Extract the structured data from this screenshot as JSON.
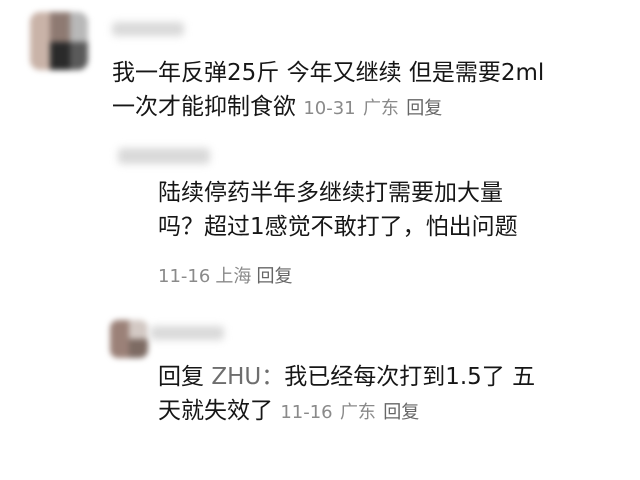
{
  "comments": [
    {
      "line1": "我一年反弹25斤 今年又继续 但是需要2ml",
      "line2_text": "一次才能抑制食欲",
      "date": "10-31",
      "location": "广东",
      "reply_label": "回复"
    },
    {
      "line1": "陆续停药半年多继续打需要加大量",
      "line2": "吗？超过1感觉不敢打了，怕出问题",
      "date": "11-16",
      "location": "上海",
      "reply_label": "回复"
    },
    {
      "reply_prefix": "回复",
      "mention": "ZHU：",
      "line1_rest": "我已经每次打到1.5了 五",
      "line2_text": "天就失效了",
      "date": "11-16",
      "location": "广东",
      "reply_label": "回复"
    }
  ]
}
